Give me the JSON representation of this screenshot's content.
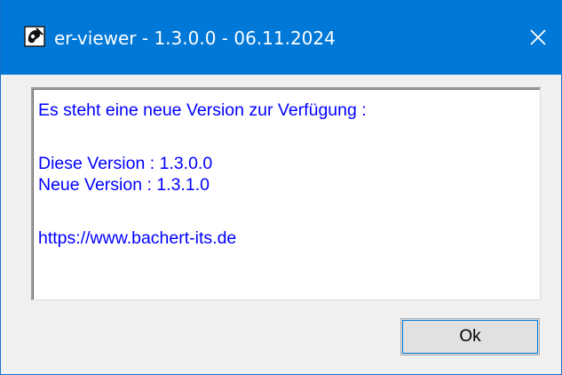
{
  "window": {
    "title": "er-viewer - 1.3.0.0 - 06.11.2024",
    "title_bar_color": "#0078d7",
    "close_icon": "close-icon",
    "app_icon": "viewer-app-icon"
  },
  "message": {
    "text_color": "#0000ff",
    "lines": [
      "Es steht eine neue Version zur Verfügung :",
      "Diese Version : 1.3.0.0",
      "Neue Version : 1.3.1.0",
      "https://www.bachert-its.de"
    ]
  },
  "buttons": {
    "ok_label": "Ok"
  }
}
